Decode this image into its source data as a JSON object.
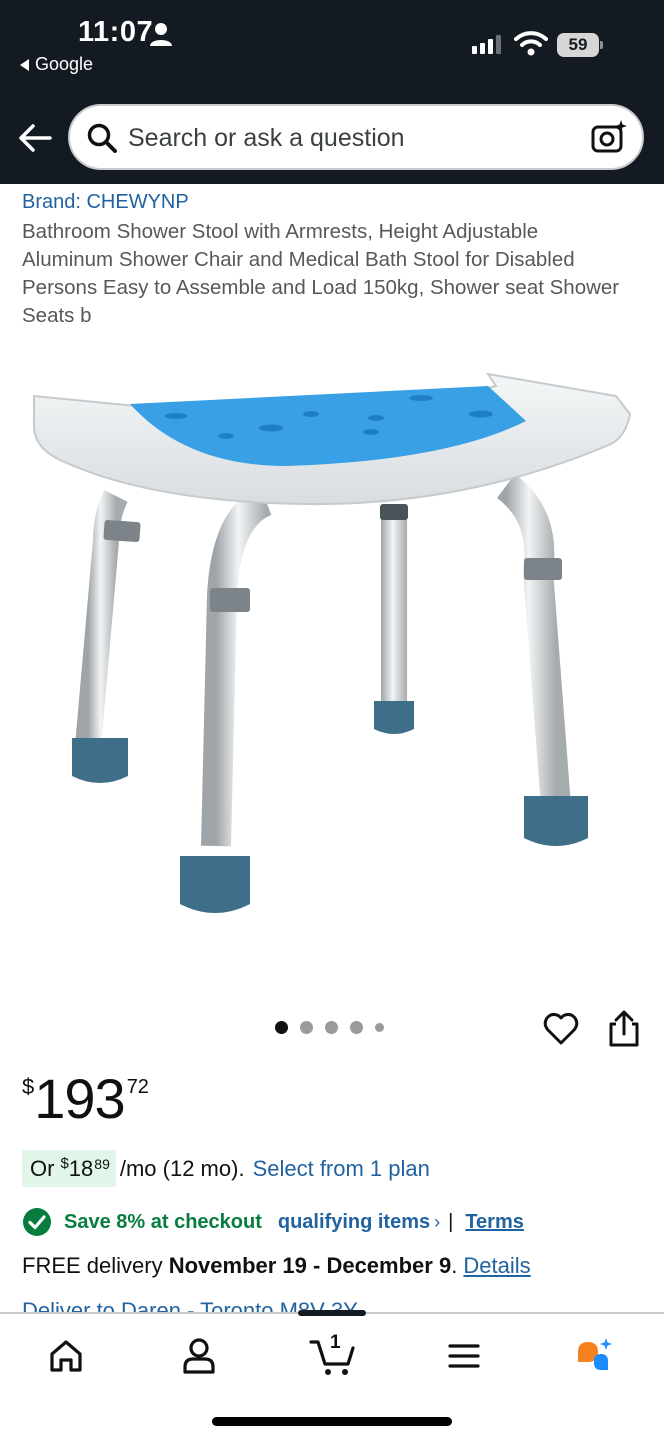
{
  "status_bar": {
    "time": "11:07",
    "back_app": "Google",
    "battery": "59"
  },
  "header": {
    "search_placeholder": "Search or ask a question"
  },
  "product": {
    "brand": "Brand: CHEWYNP",
    "title": "Bathroom Shower Stool with Armrests, Height Adjustable Aluminum Shower Chair and Medical Bath Stool for Disabled Persons Easy to Assemble and Load 150kg, Shower seat Shower Seats b",
    "image_count": 5,
    "image_index": 1
  },
  "price": {
    "symbol": "$",
    "whole": "193",
    "fraction": "72"
  },
  "monthly": {
    "or": "Or",
    "symbol": "$",
    "whole": "18",
    "fraction": "89",
    "rest": "/mo (12 mo).",
    "link": "Select from 1 plan"
  },
  "savings": {
    "text": "Save 8% at checkout",
    "link": "qualifying items",
    "chevron": "›",
    "separator": "|",
    "terms": "Terms"
  },
  "delivery": {
    "prefix": "FREE delivery ",
    "dates": "November 19 - December 9",
    "suffix": ". ",
    "details": "Details"
  },
  "peek_text": "Deliver to Daren - Toronto M8V 3Y",
  "bottom_nav": {
    "items": [
      "home-icon",
      "account-icon",
      "cart-icon",
      "menu-icon",
      "rufus-icon"
    ],
    "cart_count": "1"
  },
  "colors": {
    "header_bg": "#131a22",
    "link": "#2162a1",
    "savings_green": "#067d3e",
    "monthly_highlight": "#e1f5e8",
    "seat_blue": "#3aa0e6",
    "foot_teal": "#3f6f88",
    "rufus_orange": "#f5821f",
    "rufus_blue": "#1a8cff"
  }
}
